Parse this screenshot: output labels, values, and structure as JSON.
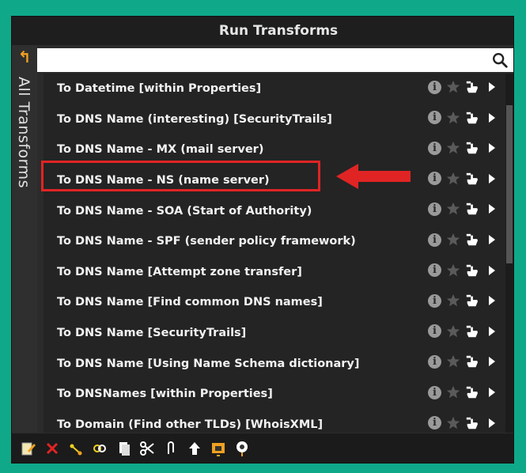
{
  "window": {
    "title": "Run Transforms"
  },
  "sidebar": {
    "label": "All Transforms",
    "back_icon": "back-arrow-icon"
  },
  "search": {
    "value": "",
    "placeholder": "",
    "icon": "search-icon"
  },
  "transforms": [
    {
      "label": "To Datetime [within Properties]"
    },
    {
      "label": "To DNS Name (interesting) [SecurityTrails]"
    },
    {
      "label": "To DNS Name - MX (mail server)"
    },
    {
      "label": "To DNS Name - NS (name server)",
      "highlighted": true
    },
    {
      "label": "To DNS Name - SOA (Start of Authority)"
    },
    {
      "label": "To DNS Name - SPF (sender policy framework)"
    },
    {
      "label": "To DNS Name [Attempt zone transfer]"
    },
    {
      "label": "To DNS Name [Find common DNS names]"
    },
    {
      "label": "To DNS Name [SecurityTrails]"
    },
    {
      "label": "To DNS Name [Using Name Schema dictionary]"
    },
    {
      "label": "To DNSNames [within Properties]"
    },
    {
      "label": "To Domain (Find other TLDs) [WhoisXML]"
    }
  ],
  "row_icons": [
    "info-icon",
    "star-icon",
    "run-hand-icon",
    "expand-arrow-icon"
  ],
  "toolbar": {
    "icons": [
      "edit-icon",
      "delete-icon",
      "link-icon",
      "bookmark-icon",
      "copy-icon",
      "cut-icon",
      "attach-icon",
      "up-arrow-icon",
      "layout-icon",
      "pin-icon"
    ]
  },
  "colors": {
    "background": "#0fa98a",
    "panel": "#2b2b2b",
    "highlight": "#e02424",
    "accent": "#f0a020"
  }
}
